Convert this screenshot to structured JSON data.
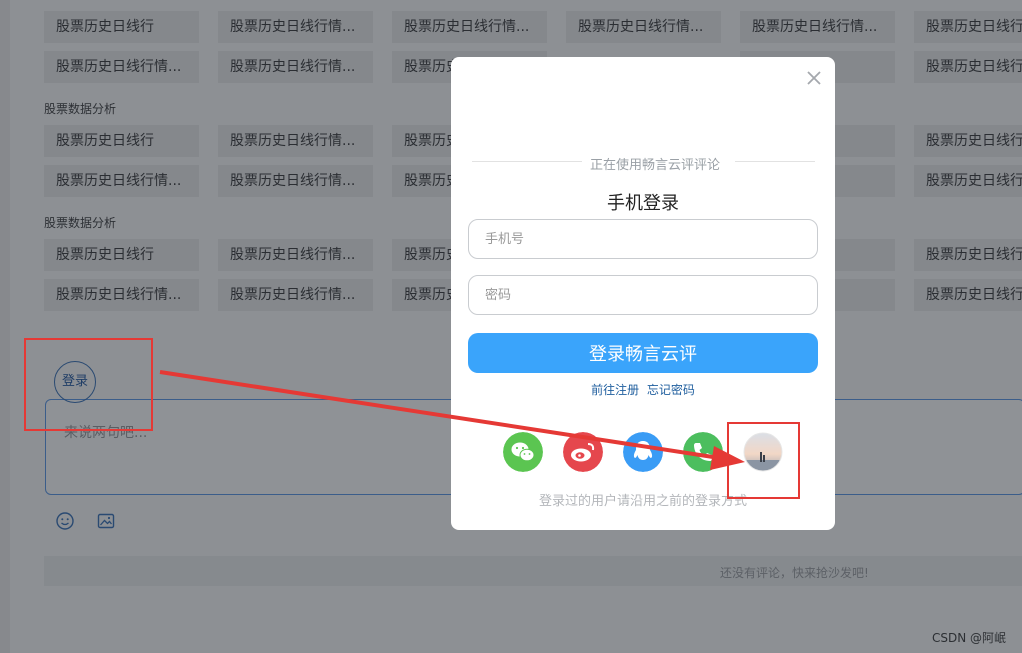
{
  "background": {
    "tag_short": "股票历史日线行",
    "tag_long": "股票历史日线行情...",
    "tag_cut": "股票历史",
    "tag_frag": "行",
    "tag_frag2": "行情...",
    "section_label": "股票数据分析"
  },
  "comment": {
    "login_label": "登录",
    "placeholder": "来说两句吧...",
    "empty_text": "还没有评论，快来抢沙发吧!"
  },
  "watermark": "CSDN @阿岷",
  "modal": {
    "using_text": "正在使用畅言云评评论",
    "title": "手机登录",
    "phone_placeholder": "手机号",
    "password_placeholder": "密码",
    "submit_label": "登录畅言云评",
    "register_link": "前往注册",
    "forgot_link": "忘记密码",
    "hint": "登录过的用户请沿用之前的登录方式",
    "social_icons": [
      "wechat-icon",
      "weibo-icon",
      "qq-icon",
      "phone-icon",
      "avatar-icon"
    ]
  },
  "colors": {
    "primary": "#3aa4fb",
    "wechat": "#5bc551",
    "weibo": "#e5474d",
    "qq": "#3a9cf5",
    "phone": "#4cbe5e",
    "annotation": "#e53935"
  }
}
